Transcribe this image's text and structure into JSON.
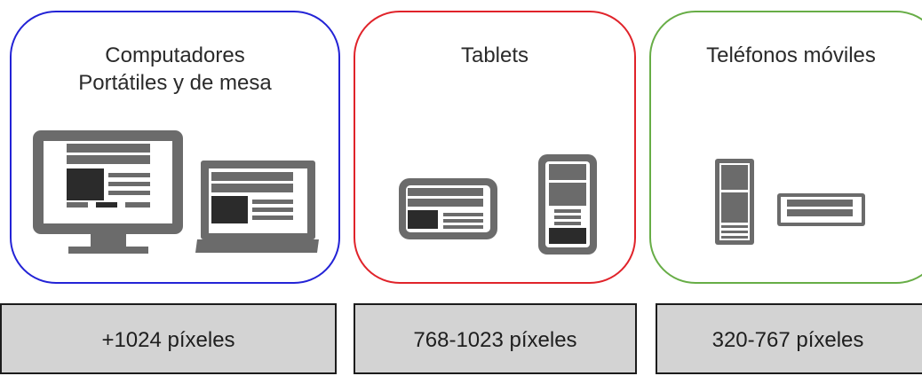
{
  "categories": [
    {
      "id": "desktop",
      "title_lines": [
        "Computadores",
        "Portátiles y de mesa"
      ],
      "border_color": "#2323d6",
      "range_label": "+1024 píxeles",
      "icons": [
        "desktop-monitor-icon",
        "laptop-icon"
      ]
    },
    {
      "id": "tablet",
      "title_lines": [
        "Tablets"
      ],
      "border_color": "#e0232a",
      "range_label": "768-1023 píxeles",
      "icons": [
        "tablet-landscape-icon",
        "tablet-portrait-icon"
      ]
    },
    {
      "id": "phone",
      "title_lines": [
        "Teléfonos móviles"
      ],
      "border_color": "#67ad46",
      "range_label": "320-767 píxeles",
      "icons": [
        "phone-portrait-icon",
        "phone-landscape-icon"
      ]
    }
  ],
  "colors": {
    "device_gray": "#6b6b6b",
    "device_dark": "#2b2b2b",
    "range_fill": "#d3d3d3"
  }
}
